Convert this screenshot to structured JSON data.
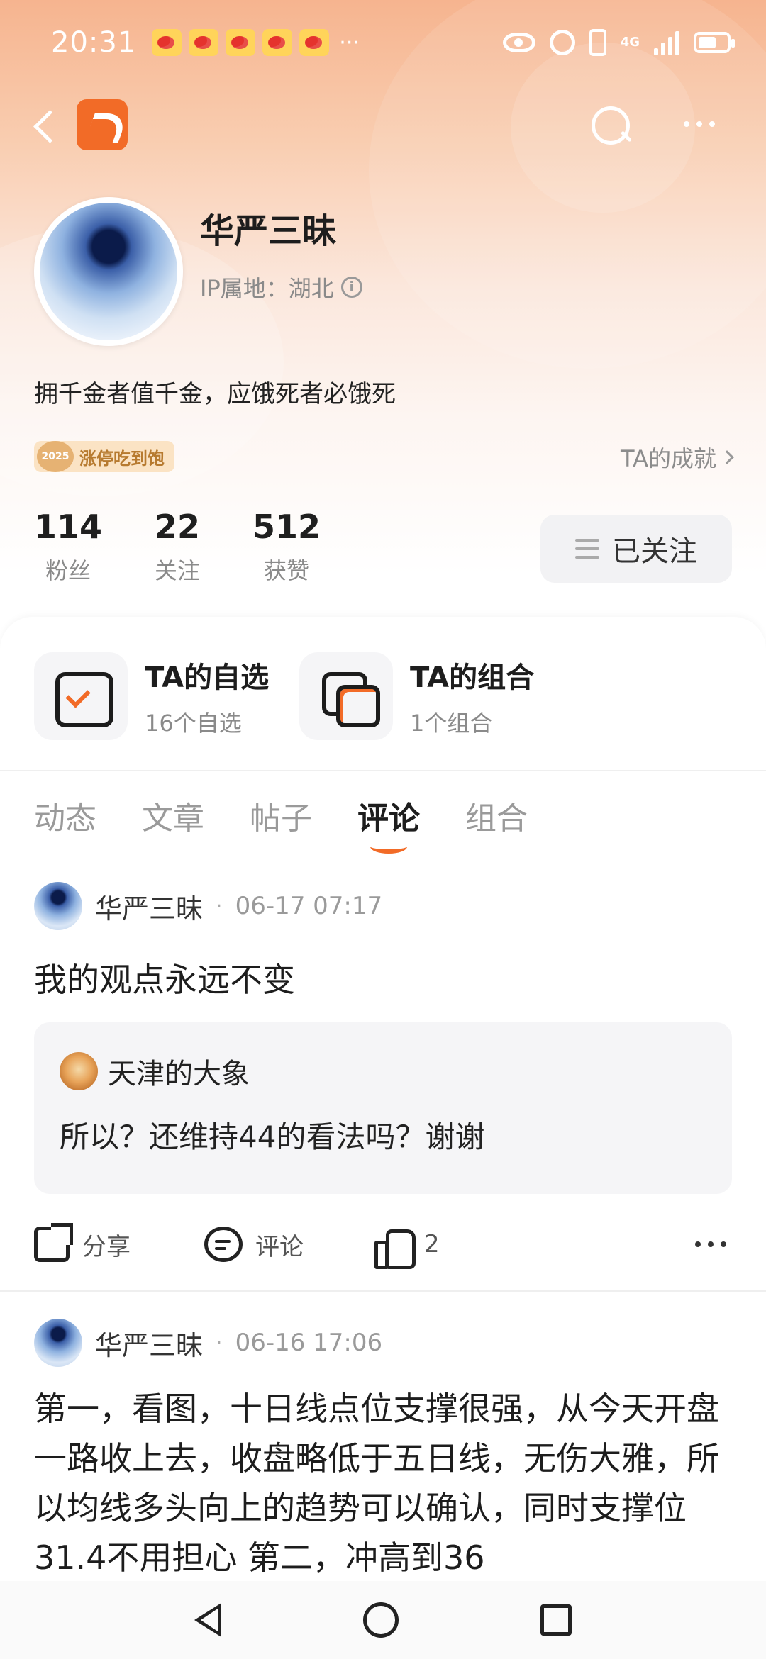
{
  "status_bar": {
    "time": "20:31",
    "more": "···",
    "network": "4G"
  },
  "nav": {
    "back_icon": "back-arrow-icon",
    "logo_icon": "app-logo-icon",
    "search_icon": "search-icon",
    "more_icon": "more-dots-icon"
  },
  "profile": {
    "name": "华严三昧",
    "ip_label": "IP属地：湖北",
    "bio": "拥千金者值千金，应饿死者必饿死",
    "badge_year": "2025",
    "badge_text": "涨停吃到饱",
    "achievement_link": "TA的成就",
    "stats": [
      {
        "value": "114",
        "label": "粉丝"
      },
      {
        "value": "22",
        "label": "关注"
      },
      {
        "value": "512",
        "label": "获赞"
      }
    ],
    "follow_button": "已关注"
  },
  "quick_entries": [
    {
      "title": "TA的自选",
      "sub": "16个自选"
    },
    {
      "title": "TA的组合",
      "sub": "1个组合"
    }
  ],
  "tabs": [
    {
      "label": "动态"
    },
    {
      "label": "文章"
    },
    {
      "label": "帖子"
    },
    {
      "label": "评论",
      "active": true
    },
    {
      "label": "组合"
    }
  ],
  "posts": [
    {
      "author": "华严三昧",
      "dot": "·",
      "time": "06-17 07:17",
      "body": "我的观点永远不变",
      "quote": {
        "author": "天津的大象",
        "text": "所以？还维持44的看法吗？谢谢"
      },
      "actions": {
        "share": "分享",
        "comment": "评论",
        "like_count": "2"
      }
    },
    {
      "author": "华严三昧",
      "dot": "·",
      "time": "06-16 17:06",
      "body": "第一，看图，十日线点位支撑很强，从今天开盘一路收上去，收盘略低于五日线，无伤大雅，所以均线多头向上的趋势可以确认，同时支撑位31.4不用担心  第二，冲高到36"
    }
  ],
  "colors": {
    "accent": "#f26b27",
    "badge_bg": "#fbe3c4"
  }
}
